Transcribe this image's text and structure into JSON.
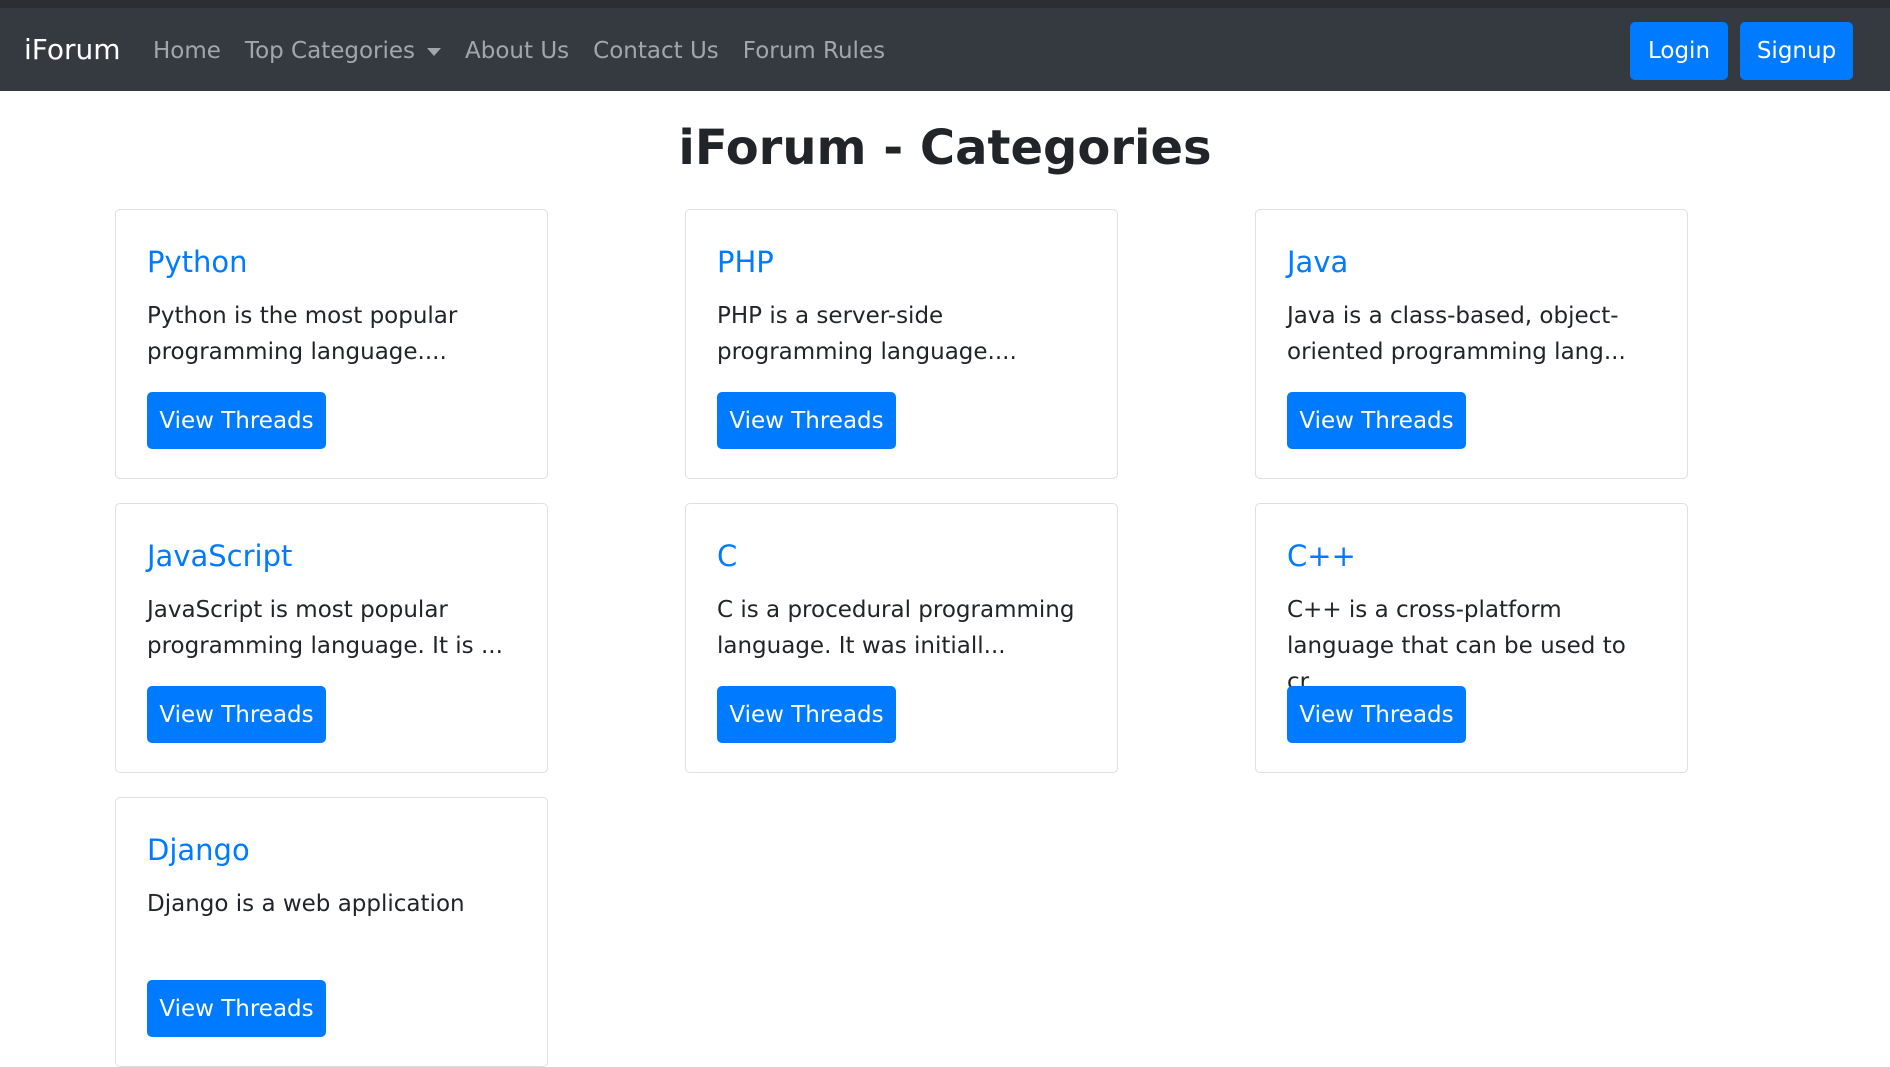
{
  "navbar": {
    "brand": "iForum",
    "links": [
      {
        "label": "Home"
      },
      {
        "label": "Top Categories"
      },
      {
        "label": "About Us"
      },
      {
        "label": "Contact Us"
      },
      {
        "label": "Forum Rules"
      }
    ],
    "login_label": "Login",
    "signup_label": "Signup"
  },
  "page": {
    "title": "iForum - Categories"
  },
  "categories": [
    {
      "title": "Python",
      "description": "Python is the most popular programming language....",
      "button": "View Threads"
    },
    {
      "title": "PHP",
      "description": "PHP is a server-side programming language....",
      "button": "View Threads"
    },
    {
      "title": "Java",
      "description": "Java is a class-based, object-oriented programming lang...",
      "button": "View Threads"
    },
    {
      "title": "JavaScript",
      "description": "JavaScript is most popular programming language. It is ...",
      "button": "View Threads"
    },
    {
      "title": "C",
      "description": "C is a procedural programming language. It was initiall...",
      "button": "View Threads"
    },
    {
      "title": "C++",
      "description": "C++ is a cross-platform language that can be used to cr...",
      "button": "View Threads"
    },
    {
      "title": "Django",
      "description": "Django is a web application",
      "button": "View Threads"
    }
  ],
  "colors": {
    "navbar_bg": "#343a40",
    "primary": "#007bff",
    "text": "#212529"
  }
}
